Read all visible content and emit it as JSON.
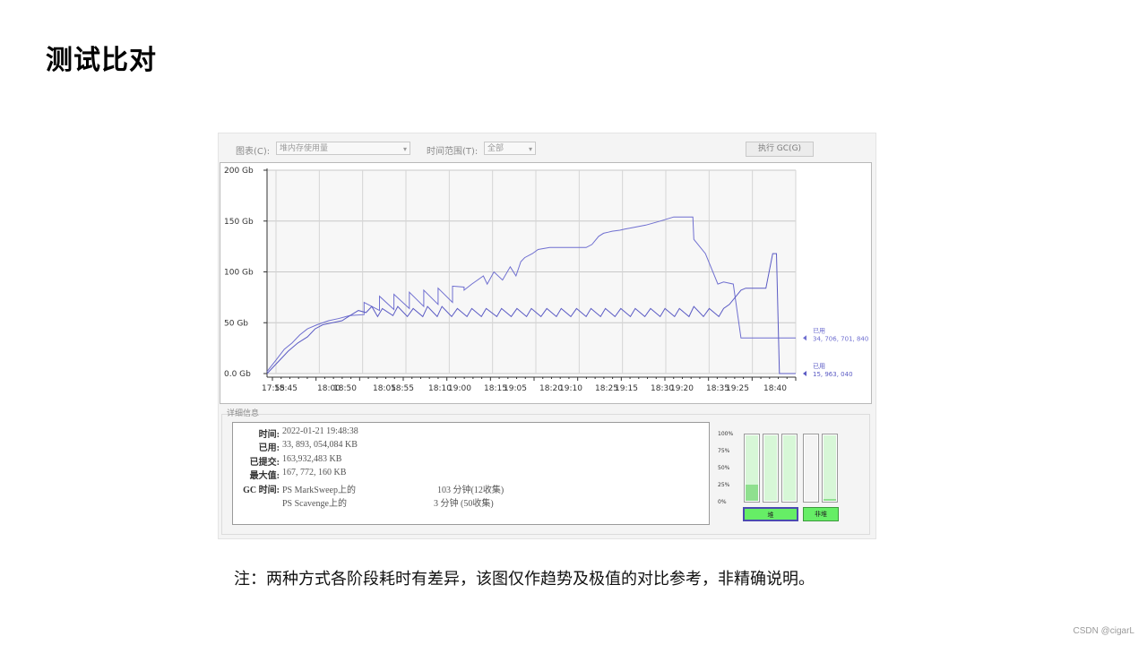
{
  "slide": {
    "title": "测试比对",
    "note": "注：两种方式各阶段耗时有差异，该图仅作趋势及极值的对比参考，非精确说明。",
    "watermark": "CSDN @cigarL"
  },
  "toolbar": {
    "chart_label": "图表(C):",
    "chart_value": "堆内存使用量",
    "range_label": "时间范围(T):",
    "range_value": "全部",
    "gc_button": "执行 GC(G)"
  },
  "chart_data": {
    "type": "line",
    "ylabel": "",
    "yticks": [
      "200 Gb",
      "150 Gb",
      "100 Gb",
      "50 Gb",
      "0.0 Gb"
    ],
    "ytick_values": [
      200,
      150,
      100,
      50,
      0
    ],
    "ylim": [
      0,
      200
    ],
    "xticks": [
      "17:55",
      "18:45",
      "18:00",
      "18:50",
      "18:05",
      "18:55",
      "18:10",
      "19:00",
      "18:15",
      "19:05",
      "18:20",
      "19:10",
      "18:25",
      "19:15",
      "18:30",
      "19:20",
      "18:35",
      "19:25",
      "18:40"
    ],
    "grid": true,
    "series": [
      {
        "name": "已用",
        "color": "#6f6fd0",
        "end_label": "34, 706, 701, 840",
        "x": [
          0,
          1,
          1.8,
          2.6,
          3.4,
          4.2,
          5.2,
          6.4,
          7.4,
          8.6,
          10.1,
          10.1,
          11.7,
          11.7,
          13.2,
          13.2,
          14.8,
          14.8,
          16.3,
          16.3,
          17.8,
          17.8,
          19.3,
          19.3,
          20.5,
          20.5,
          21.3,
          21.9,
          22.5,
          22.9,
          23.6,
          24.5,
          25.3,
          25.9,
          26.4,
          26.8,
          27.6,
          28.2,
          29.4,
          29.4,
          33.2,
          33.8,
          34.5,
          35,
          35.5,
          35.9,
          36.7,
          37.2,
          39.4,
          40.9,
          42.3,
          44.3,
          44.4,
          45.6,
          46.9,
          47.5,
          48.5,
          49.3,
          55
        ],
        "y": [
          2,
          14,
          24,
          30,
          38,
          44,
          48,
          52,
          54,
          57,
          58,
          70,
          62,
          76,
          63,
          78,
          64,
          80,
          66,
          82,
          68,
          84,
          70,
          86,
          85,
          82,
          88,
          92,
          96,
          88,
          100,
          92,
          105,
          96,
          110,
          114,
          118,
          122,
          124,
          124,
          124,
          127,
          135,
          138,
          139,
          140,
          141,
          142,
          146,
          150,
          154,
          154,
          132,
          118,
          88,
          90,
          88,
          35,
          35
        ]
      },
      {
        "name": "已用",
        "color": "#5b5bc4",
        "end_label": "15, 963, 040",
        "x": [
          0,
          1.2,
          2.2,
          3.2,
          4.2,
          5,
          5.8,
          6.8,
          7.8,
          8.3,
          8.8,
          9.5,
          10.3,
          10.9,
          11.5,
          12,
          13.1,
          13.6,
          14.6,
          15.2,
          16.2,
          16.7,
          17.7,
          18.2,
          19.2,
          19.8,
          20.8,
          21.3,
          22.3,
          22.8,
          23.9,
          24.4,
          25.4,
          26,
          27,
          27.5,
          28.5,
          29.1,
          30.1,
          30.6,
          31.6,
          32.2,
          33.2,
          33.7,
          34.7,
          35.2,
          36.2,
          36.8,
          37.8,
          38.3,
          39.3,
          39.9,
          40.9,
          41.4,
          42.4,
          42.9,
          43.9,
          44.4,
          45.4,
          46,
          47,
          47.5,
          48.1,
          49.3,
          49.8,
          51.9,
          52.6,
          53,
          53.3,
          55
        ],
        "y": [
          0,
          12,
          22,
          30,
          36,
          44,
          48,
          50,
          52,
          55,
          58,
          62,
          60,
          66,
          56,
          64,
          57,
          66,
          56,
          64,
          56,
          66,
          56,
          66,
          56,
          64,
          56,
          64,
          56,
          64,
          56,
          64,
          56,
          64,
          56,
          64,
          56,
          64,
          56,
          64,
          56,
          64,
          56,
          64,
          56,
          64,
          56,
          64,
          56,
          64,
          56,
          64,
          56,
          64,
          56,
          64,
          56,
          66,
          56,
          64,
          56,
          64,
          68,
          82,
          84,
          84,
          118,
          118,
          0,
          0
        ]
      }
    ]
  },
  "details": {
    "group_title": "详细信息",
    "rows": [
      {
        "label": "时间:",
        "value": "2022-01-21 19:48:38"
      },
      {
        "label": "已用:",
        "value": "33, 893, 054,084 KB"
      },
      {
        "label": "已提交:",
        "value": "163,932,483 KB"
      },
      {
        "label": "最大值:",
        "value": "167, 772, 160 KB"
      },
      {
        "label": "GC 时间:",
        "value": "PS MarkSweep上的",
        "extra": "103 分钟(12收集)"
      },
      {
        "label": "",
        "value": "PS Scavenge上的",
        "extra": "3  分钟 (50收集)"
      }
    ]
  },
  "gauges": {
    "ticks": [
      "100%",
      "75%",
      "50%",
      "25%",
      "0%"
    ],
    "bars": [
      {
        "name": "heap-1",
        "level": 0.27
      },
      {
        "name": "heap-2",
        "level": 0.0
      },
      {
        "name": "heap-3",
        "level": 0.0
      },
      {
        "name": "nonheap-1",
        "level": 0.0
      },
      {
        "name": "nonheap-2",
        "level": 0.06
      }
    ],
    "heap_label": "堆",
    "nonheap_label": "非堆"
  }
}
